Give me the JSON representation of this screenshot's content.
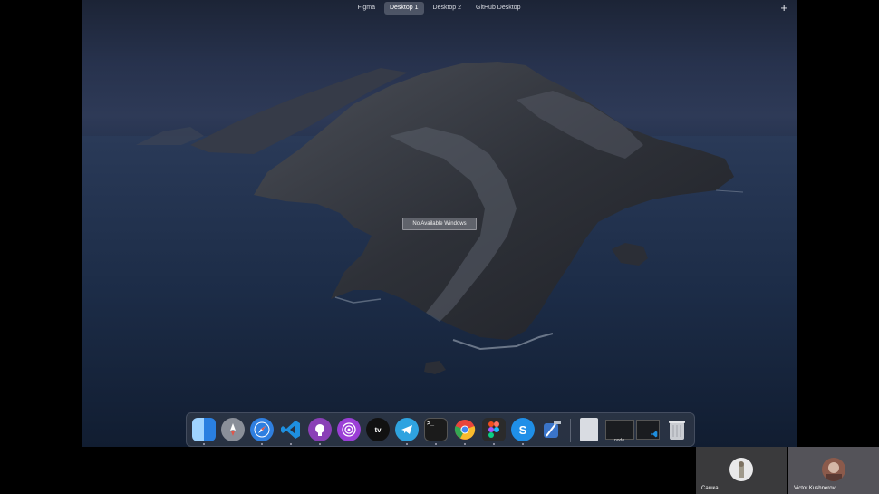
{
  "spaces_bar": {
    "tabs": [
      {
        "label": "Figma",
        "active": false
      },
      {
        "label": "Desktop 1",
        "active": true
      },
      {
        "label": "Desktop 2",
        "active": false
      },
      {
        "label": "GitHub Desktop",
        "active": false
      }
    ],
    "add_label": "+"
  },
  "desktop": {
    "no_windows_label": "No Available Windows"
  },
  "dock": {
    "apps": [
      {
        "name": "finder-icon",
        "glyph": "",
        "color": "#3a8ee6"
      },
      {
        "name": "launchpad-icon",
        "glyph": "",
        "color": "#8a8f99"
      },
      {
        "name": "safari-icon",
        "glyph": "",
        "color": "#2f7fe0"
      },
      {
        "name": "vscode-icon",
        "glyph": "",
        "color": "#1e6fc4"
      },
      {
        "name": "github-icon",
        "glyph": "",
        "color": "#8a3fb7"
      },
      {
        "name": "podcasts-icon",
        "glyph": "",
        "color": "#9b3fd6"
      },
      {
        "name": "apple-tv-icon",
        "glyph": "tv",
        "color": "#111111"
      },
      {
        "name": "telegram-icon",
        "glyph": "",
        "color": "#2fa3e0"
      },
      {
        "name": "terminal-icon",
        "glyph": ">_",
        "color": "#1b1b1b"
      },
      {
        "name": "chrome-icon",
        "glyph": "",
        "color": "#e8e8e8"
      },
      {
        "name": "figma-icon",
        "glyph": "",
        "color": "#2b2b2b"
      },
      {
        "name": "skype-icon",
        "glyph": "S",
        "color": "#1f8fe8"
      },
      {
        "name": "xcode-icon",
        "glyph": "",
        "color": "#3a74c9"
      }
    ],
    "minimized_label": "node ..."
  },
  "video_call": {
    "participants": [
      {
        "name": "Сашка"
      },
      {
        "name": "Victor Kushnerov"
      }
    ]
  }
}
